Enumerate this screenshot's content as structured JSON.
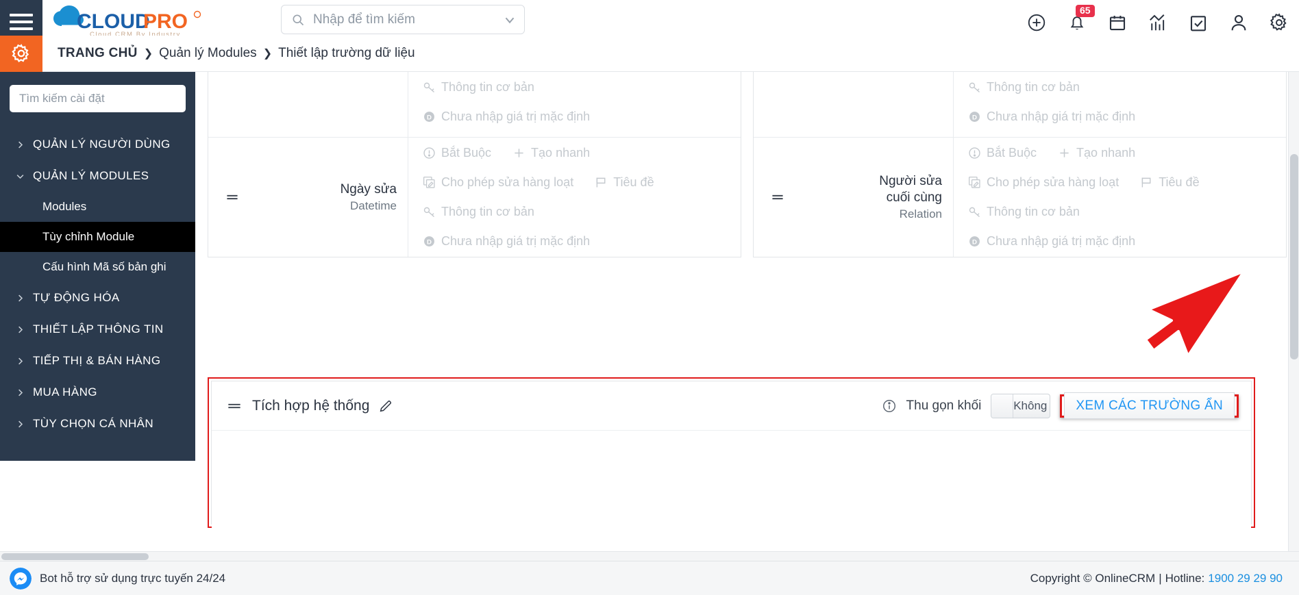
{
  "topbar": {
    "menu_icon": "hamburger-icon",
    "brand": {
      "name_cloud": "CLOUD",
      "name_pro": "PRO",
      "tagline": "Cloud CRM By Industry"
    },
    "search": {
      "placeholder": "Nhập để tìm kiếm",
      "value": "",
      "icon": "search-icon",
      "dropdown_icon": "chevron-down-icon"
    },
    "icons": [
      {
        "name": "plus-circle-icon"
      },
      {
        "name": "bell-icon",
        "badge": "65"
      },
      {
        "name": "calendar-icon"
      },
      {
        "name": "analytics-icon"
      },
      {
        "name": "checkbox-icon"
      },
      {
        "name": "user-icon"
      },
      {
        "name": "gear-icon"
      }
    ]
  },
  "breadcrumb": {
    "gear_icon": "settings-gear-icon",
    "home": "TRANG CHỦ",
    "separator": "❯",
    "items": [
      "Quản lý Modules",
      "Thiết lập trường dữ liệu"
    ]
  },
  "sidebar": {
    "search_placeholder": "Tìm kiếm cài đặt",
    "search_value": "",
    "groups": [
      {
        "label": "QUẢN LÝ NGƯỜI DÙNG",
        "expanded": false
      },
      {
        "label": "QUẢN LÝ MODULES",
        "expanded": true
      }
    ],
    "subitems": [
      {
        "label": "Modules",
        "active": false
      },
      {
        "label": "Tùy chỉnh Module",
        "active": true
      },
      {
        "label": "Cấu hình Mã số bản ghi",
        "active": false
      }
    ],
    "groups_after": [
      {
        "label": "TỰ ĐỘNG HÓA",
        "expanded": false
      },
      {
        "label": "THIẾT LẬP THÔNG TIN",
        "expanded": false
      },
      {
        "label": "TIẾP THỊ & BÁN HÀNG",
        "expanded": false
      },
      {
        "label": "MUA HÀNG",
        "expanded": false
      },
      {
        "label": "TÙY CHỌN CÁ NHÂN",
        "expanded": false
      }
    ]
  },
  "main": {
    "left_block": {
      "partial_row_tags": [
        {
          "icon": "key-icon",
          "label": "Thông tin cơ bản"
        },
        {
          "icon": "default-value-icon",
          "label": "Chưa nhập giá trị mặc định"
        }
      ],
      "rows": [
        {
          "field_name": "Ngày sửa",
          "field_type": "Datetime",
          "drag_icon": "drag-handle-icon",
          "tags": [
            {
              "icon": "required-icon",
              "label": "Bắt Buộc"
            },
            {
              "icon": "plus-icon",
              "label": "Tạo nhanh"
            },
            {
              "icon": "mass-edit-icon",
              "label": "Cho phép sửa hàng loạt"
            },
            {
              "icon": "flag-icon",
              "label": "Tiêu đề"
            },
            {
              "icon": "key-icon",
              "label": "Thông tin cơ bản"
            },
            {
              "icon": "default-value-icon",
              "label": "Chưa nhập giá trị mặc định"
            }
          ]
        }
      ]
    },
    "right_block": {
      "partial_row_tags": [
        {
          "icon": "key-icon",
          "label": "Thông tin cơ bản"
        },
        {
          "icon": "default-value-icon",
          "label": "Chưa nhập giá trị mặc định"
        }
      ],
      "rows": [
        {
          "field_name_line1": "Người sửa",
          "field_name_line2": "cuối cùng",
          "field_type": "Relation",
          "drag_icon": "drag-handle-icon",
          "tags": [
            {
              "icon": "required-icon",
              "label": "Bắt Buộc"
            },
            {
              "icon": "plus-icon",
              "label": "Tạo nhanh"
            },
            {
              "icon": "mass-edit-icon",
              "label": "Cho phép sửa hàng loạt"
            },
            {
              "icon": "flag-icon",
              "label": "Tiêu đề"
            },
            {
              "icon": "key-icon",
              "label": "Thông tin cơ bản"
            },
            {
              "icon": "default-value-icon",
              "label": "Chưa nhập giá trị mặc định"
            }
          ]
        }
      ]
    },
    "highlighted_section": {
      "title": "Tích hợp hệ thống",
      "drag_icon": "drag-handle-icon",
      "edit_icon": "pencil-icon",
      "info_icon": "info-circle-icon",
      "collapse_label": "Thu gọn khối",
      "toggle_value": "Không",
      "toggle_state": "off",
      "hidden_fields_button": "XEM CÁC TRƯỜNG ẨN",
      "highlight_color": "#e01b1b",
      "button_text_color": "#2196f3"
    }
  },
  "chatbar": {
    "label": "Bot hỗ trợ sử dụng trực tuyến 24/24",
    "icon": "messenger-icon"
  },
  "footer": {
    "copyright": "Copyright © OnlineCRM",
    "divider": "|",
    "hotline_label": "Hotline:",
    "hotline": "1900 29 29 90"
  },
  "annotation": {
    "arrow": "red-arrow-pointer",
    "color": "#e8191a"
  }
}
